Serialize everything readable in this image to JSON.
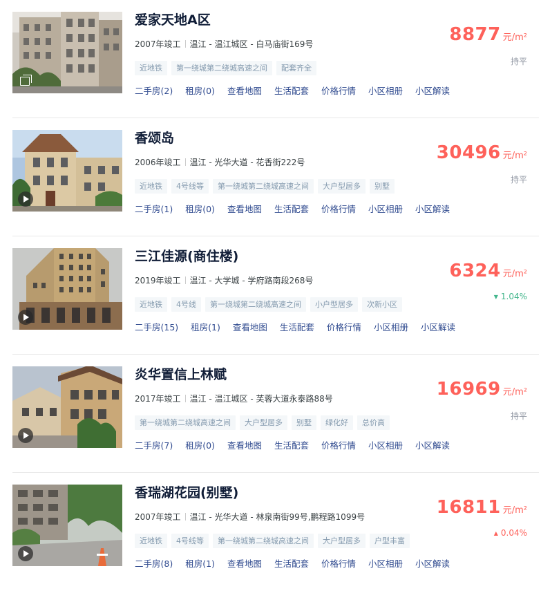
{
  "listings": [
    {
      "title": "爱家天地A区",
      "year": "2007年竣工",
      "location": "温江 - 温江城区 - 白马庙街169号",
      "tags": [
        "近地铁",
        "第一绕城第二绕城高速之间",
        "配套齐全"
      ],
      "links": [
        "二手房(2)",
        "租房(0)",
        "查看地图",
        "生活配套",
        "价格行情",
        "小区相册",
        "小区解读"
      ],
      "price": "8877",
      "unit": "元/m²",
      "trend": "持平",
      "trend_dir": "flat",
      "media_icon": "gallery-icon"
    },
    {
      "title": "香颂岛",
      "year": "2006年竣工",
      "location": "温江 - 光华大道 - 花香街222号",
      "tags": [
        "近地铁",
        "4号线等",
        "第一绕城第二绕城高速之间",
        "大户型居多",
        "别墅"
      ],
      "links": [
        "二手房(1)",
        "租房(0)",
        "查看地图",
        "生活配套",
        "价格行情",
        "小区相册",
        "小区解读"
      ],
      "price": "30496",
      "unit": "元/m²",
      "trend": "持平",
      "trend_dir": "flat",
      "media_icon": "play-icon"
    },
    {
      "title": "三江佳源(商住楼)",
      "year": "2019年竣工",
      "location": "温江 - 大学城 - 学府路南段268号",
      "tags": [
        "近地铁",
        "4号线",
        "第一绕城第二绕城高速之间",
        "小户型居多",
        "次新小区"
      ],
      "links": [
        "二手房(15)",
        "租房(1)",
        "查看地图",
        "生活配套",
        "价格行情",
        "小区相册",
        "小区解读"
      ],
      "price": "6324",
      "unit": "元/m²",
      "trend": "1.04%",
      "trend_dir": "down",
      "media_icon": "play-icon"
    },
    {
      "title": "炎华置信上林赋",
      "year": "2017年竣工",
      "location": "温江 - 温江城区 - 芙蓉大道永泰路88号",
      "tags": [
        "第一绕城第二绕城高速之间",
        "大户型居多",
        "别墅",
        "绿化好",
        "总价高"
      ],
      "links": [
        "二手房(7)",
        "租房(0)",
        "查看地图",
        "生活配套",
        "价格行情",
        "小区相册",
        "小区解读"
      ],
      "price": "16969",
      "unit": "元/m²",
      "trend": "持平",
      "trend_dir": "flat",
      "media_icon": "play-icon"
    },
    {
      "title": "香瑞湖花园(别墅)",
      "year": "2007年竣工",
      "location": "温江 - 光华大道 - 林泉南街99号,鹏程路1099号",
      "tags": [
        "近地铁",
        "4号线等",
        "第一绕城第二绕城高速之间",
        "大户型居多",
        "户型丰富"
      ],
      "links": [
        "二手房(8)",
        "租房(1)",
        "查看地图",
        "生活配套",
        "价格行情",
        "小区相册",
        "小区解读"
      ],
      "price": "16811",
      "unit": "元/m²",
      "trend": "0.04%",
      "trend_dir": "up",
      "media_icon": "play-icon"
    }
  ],
  "colors": {
    "price": "#fe615a",
    "link": "#2f4a8f",
    "title": "#101d37",
    "tag_bg": "#f4f7f9",
    "tag_text": "#849aae",
    "trend_down": "#43b68c",
    "trend_flat": "#9399a5"
  }
}
